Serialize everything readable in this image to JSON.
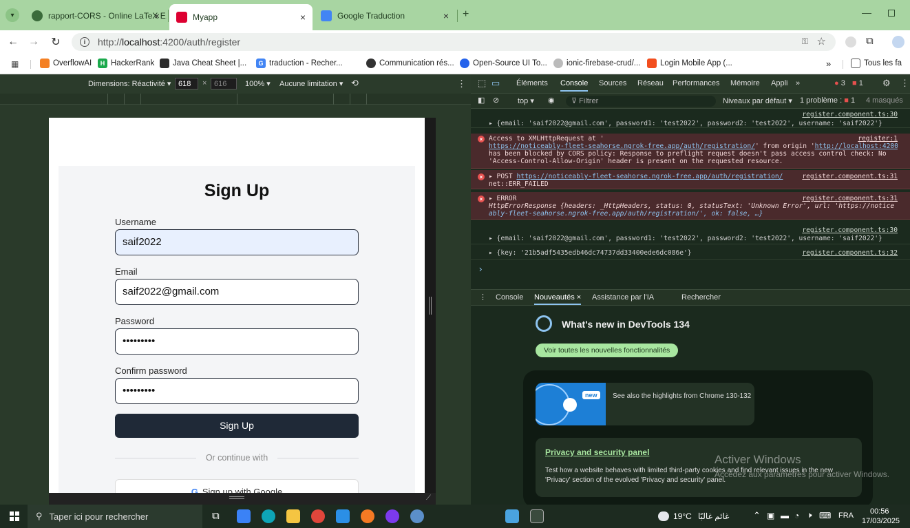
{
  "browser": {
    "tabs": [
      {
        "title": "rapport-CORS - Online LaTeX E...",
        "favicon": "overleaf-icon"
      },
      {
        "title": "Myapp",
        "favicon": "angular-icon"
      },
      {
        "title": "Google Traduction",
        "favicon": "google-translate-icon"
      }
    ],
    "url_prefix": "http://",
    "url_host": "localhost",
    "url_rest": ":4200/auth/register",
    "bookmarks": [
      "OverflowAI",
      "HackerRank",
      "Java Cheat Sheet |...",
      "traduction - Recher...",
      "Communication rés...",
      "Open-Source UI To...",
      "ionic-firebase-crud/...",
      "Login Mobile App (..."
    ],
    "bookmarks_overflow": "»",
    "bookmarks_folder": "Tous les fa"
  },
  "devicebar": {
    "dimensions_label": "Dimensions: Réactivité ▾",
    "width": "618",
    "times": "×",
    "height": "616",
    "zoom": "100% ▾",
    "throttle": "Aucune limitation ▾"
  },
  "app": {
    "title": "Sign Up",
    "username_label": "Username",
    "username_value": "saif2022",
    "email_label": "Email",
    "email_value": "saif2022@gmail.com",
    "password_label": "Password",
    "password_value": "•••••••••",
    "confirm_label": "Confirm password",
    "confirm_value": "•••••••••",
    "submit_label": "Sign Up",
    "divider_text": "Or continue with",
    "google_label": "Sign up with Google"
  },
  "devtools": {
    "tabs": [
      "Éléments",
      "Console",
      "Sources",
      "Réseau",
      "Performances",
      "Mémoire",
      "Appli",
      "»"
    ],
    "error_count": "3",
    "issue_count": "1",
    "console_toolbar": {
      "context": "top ▾",
      "filter_placeholder": "Filtrer",
      "levels": "Niveaux par défaut ▾",
      "problems_label": "1 problème :",
      "problems_count": "1",
      "hidden": "4 masqués"
    },
    "logs": {
      "l1_src": "register.component.ts:30",
      "l1_text": "▸ {email: 'saif2022@gmail.com', password1: 'test2022', password2: 'test2022', username: 'saif2022'}",
      "l2_src": "register:1",
      "l2_line1": "Access to XMLHttpRequest at '",
      "l2_url": "https://noticeably-fleet-seahorse.ngrok-free.app/auth/registration/",
      "l2_mid": "' from origin '",
      "l2_origin": "http://localhost:4200",
      "l2_tail": "'",
      "l2_line3": "has been blocked by CORS policy: Response to preflight request doesn't pass access control check: No",
      "l2_line4": "'Access-Control-Allow-Origin' header is present on the requested resource.",
      "l3_prefix": "▸ POST",
      "l3_url": "https://noticeably-fleet-seahorse.ngrok-free.app/auth/registration/",
      "l3_src": "register.component.ts:31",
      "l3_line2": "net::ERR_FAILED",
      "l4_prefix": "▸ ERROR",
      "l4_src": "register.component.ts:31",
      "l4_line2": "HttpErrorResponse {headers: _HttpHeaders, status: 0, statusText: 'Unknown Error', url: 'https://notice",
      "l4_line3": "ably-fleet-seahorse.ngrok-free.app/auth/registration/', ok: false, …}",
      "l5_src": "register.component.ts:30",
      "l5_text": "▸ {email: 'saif2022@gmail.com', password1: 'test2022', password2: 'test2022', username: 'saif2022'}",
      "l6_src": "register.component.ts:32",
      "l6_text": "▸ {key: '21b5adf5435edb46dc74737dd33400ede6dc086e'}",
      "prompt": "›"
    },
    "drawer_tabs": [
      "Console",
      "Nouveautés ×",
      "Assistance par l'IA",
      "Rechercher"
    ],
    "whatsnew": {
      "title": "What's new in DevTools 134",
      "button": "Voir toutes les nouvelles fonctionnalités",
      "badge": "new",
      "highlight": "See also the highlights from Chrome 130-132",
      "card_title": "Privacy and security panel",
      "card_text1": "Test how a website behaves with limited third-party cookies and find relevant issues in the new",
      "card_text2": "'Privacy' section of the evolved 'Privacy and security' panel."
    },
    "watermark1": "Activer Windows",
    "watermark2": "Accédez aux paramètres pour activer Windows."
  },
  "taskbar": {
    "search": "Taper ici pour rechercher",
    "weather": "19°C",
    "weather_text": "غائم غالبًا",
    "lang": "FRA",
    "time": "00:56",
    "date": "17/03/2025"
  },
  "colors": {
    "tabstrip": "#a8d5a2",
    "primary_button": "#1f2937",
    "console_error_bg": "#4a2a2c",
    "devtools_bg": "#1b2a1e"
  }
}
